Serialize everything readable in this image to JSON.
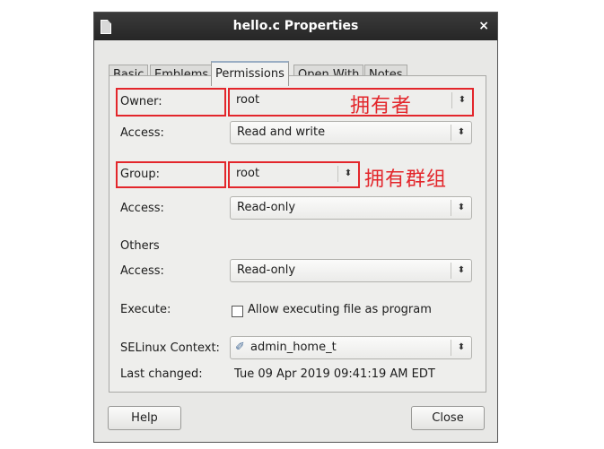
{
  "window": {
    "title": "hello.c Properties"
  },
  "tabs": [
    "Basic",
    "Emblems",
    "Permissions",
    "Open With",
    "Notes"
  ],
  "permissions": {
    "owner_label": "Owner:",
    "owner_value": "root",
    "owner_annotation": "拥有者",
    "owner_access_label": "Access:",
    "owner_access_value": "Read and write",
    "group_label": "Group:",
    "group_value": "root",
    "group_annotation": "拥有群组",
    "group_access_label": "Access:",
    "group_access_value": "Read-only",
    "others_label": "Others",
    "others_access_label": "Access:",
    "others_access_value": "Read-only",
    "execute_label": "Execute:",
    "execute_checkbox_label": "Allow executing file as program",
    "selinux_label": "SELinux Context:",
    "selinux_value": "admin_home_t",
    "last_changed_label": "Last changed:",
    "last_changed_value": "Tue 09 Apr 2019 09:41:19 AM EDT"
  },
  "buttons": {
    "help": "Help",
    "close": "Close"
  },
  "colors": {
    "annotation": "#e3262b",
    "titlebar": "#2e2e2e"
  }
}
